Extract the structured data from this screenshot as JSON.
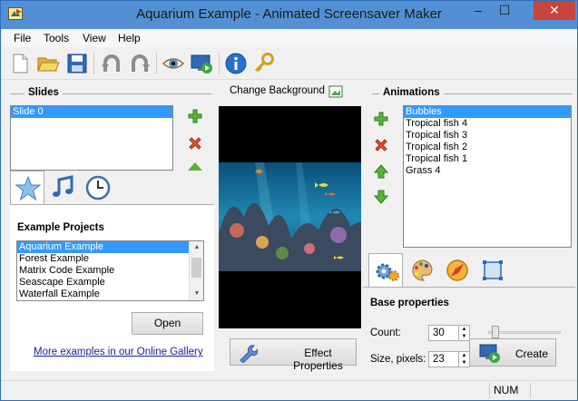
{
  "window": {
    "title": "Aquarium Example - Animated Screensaver Maker",
    "min": "–",
    "max": "☐",
    "close": "✕"
  },
  "menu": [
    "File",
    "Tools",
    "View",
    "Help"
  ],
  "slides": {
    "title": "Slides",
    "items": [
      "Slide 0"
    ],
    "selected": 0
  },
  "change_background": "Change Background",
  "example_projects": {
    "title": "Example Projects",
    "items": [
      "Aquarium Example",
      "Forest Example",
      "Matrix Code Example",
      "Seascape Example",
      "Waterfall Example"
    ],
    "selected": 0,
    "open_label": "Open",
    "gallery_link": "More examples in our Online Gallery"
  },
  "effect_properties": "Effect Properties",
  "animations": {
    "title": "Animations",
    "items": [
      "Bubbles",
      "Tropical fish 4",
      "Tropical fish 3",
      "Tropical fish 2",
      "Tropical fish 1",
      "Grass 4"
    ],
    "selected": 0
  },
  "base_properties": {
    "title": "Base properties",
    "count_label": "Count:",
    "count_value": "30",
    "size_label": "Size, pixels:",
    "size_value": "23",
    "count_slider_fraction": 0.05
  },
  "create_label": "Create",
  "status": {
    "num": "NUM"
  },
  "colors": {
    "accent": "#3399ff",
    "title_bar": "#5390d3",
    "close": "#c7453a"
  }
}
